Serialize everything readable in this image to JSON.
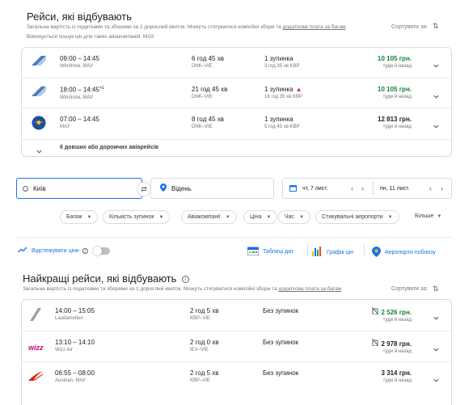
{
  "top_section": {
    "title": "Рейси, які відбувають",
    "subtitle_prefix": "Загальна вартість із податками та зборами за 1 дорослий квиток. Можуть стягуватися комісійні збори та",
    "subtitle_link": "додаткова плата за багаж",
    "subtitle_suffix": ".",
    "note": "Виконується пошук цін для таких авіакомпаній: МАУ.",
    "sort_label": "Сортувати за:"
  },
  "top_flights": [
    {
      "times": "09:00 – 14:45",
      "airline": "Windrose, МАУ",
      "duration": "6 год 45 хв",
      "route": "DNK–VIE",
      "stops": "1 зупинка",
      "stop_detail": "3 год 35 хв KBP",
      "price": "10 105 грн.",
      "price_note": "туди й назад",
      "price_color": "#188038",
      "logo": "mau-wing-icon",
      "warning": false
    },
    {
      "times": "18:00 – 14:45",
      "times_sup": "+1",
      "airline": "Windrose, МАУ",
      "duration": "21 год 45 хв",
      "route": "DNK–VIE",
      "stops": "1 зупинка",
      "stop_detail": "18 год 35 хв KBP",
      "price": "10 105 грн.",
      "price_note": "туди й назад",
      "price_color": "#188038",
      "logo": "mau-wing-icon",
      "warning": true
    },
    {
      "times": "07:00 – 14:45",
      "airline": "МАУ",
      "duration": "8 год 45 хв",
      "route": "DNK–VIE",
      "stops": "1 зупинка",
      "stop_detail": "5 год 45 хв KBP",
      "price": "12 813 грн.",
      "price_note": "туди й назад",
      "price_color": "#202124",
      "logo": "mau-emblem-icon",
      "warning": false
    }
  ],
  "more_flights": "6 довших або дорожчих авіарейсів",
  "search": {
    "origin": "Київ",
    "destination": "Відень",
    "depart_date": "чт, 7 лист.",
    "return_date": "пн, 11 лист."
  },
  "filters": [
    "Багаж",
    "Кількість зупинок",
    "Авіакомпанії",
    "Ціна",
    "Час",
    "Стикувальні аеропорти"
  ],
  "filters_more": "Більше",
  "tools": {
    "track": "Відстежувати ціни",
    "date_grid": "Таблиці дат",
    "price_graph": "Графік цін",
    "nearby": "Аеропорти поблизу"
  },
  "best_section": {
    "title": "Найкращі рейси, які відбувають",
    "subtitle_prefix": "Загальна вартість із податками та зборами за 1 дорослий квиток. Можуть стягуватися комісійні збори та",
    "subtitle_link": "додаткова плата за багаж",
    "subtitle_suffix": ".",
    "sort_label": "Сортувати за:"
  },
  "best_flights": [
    {
      "times": "14:00 – 15:05",
      "airline": "Laudamotion",
      "duration": "2 год 5 хв",
      "route": "KBP–VIE",
      "stops": "Без зупинок",
      "price": "2 526 грн.",
      "price_note": "туди й назад",
      "price_color": "#188038",
      "logo": "laudamotion-icon",
      "nobag": true
    },
    {
      "times": "13:10 – 14:10",
      "airline": "Wizz Air",
      "duration": "2 год 0 хв",
      "route": "IEV–VIE",
      "stops": "Без зупинок",
      "price": "2 978 грн.",
      "price_note": "туди й назад",
      "price_color": "#202124",
      "logo": "wizz-air-logo",
      "logo_text": "wizz",
      "nobag": true
    },
    {
      "times": "06:55 – 08:00",
      "airline": "Austrian, МАУ",
      "duration": "2 год 5 хв",
      "route": "KBP–VIE",
      "stops": "Без зупинок",
      "price": "3 314 грн.",
      "price_note": "туди й назад",
      "price_color": "#202124",
      "logo": "austrian-icon",
      "nobag": false
    }
  ]
}
